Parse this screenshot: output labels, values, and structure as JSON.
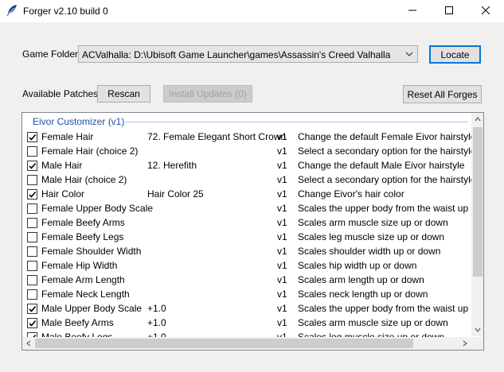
{
  "window": {
    "title": "Forger v2.10 build 0"
  },
  "game_folder": {
    "label": "Game Folder",
    "selected": "ACValhalla: D:\\Ubisoft Game Launcher\\games\\Assassin's Creed Valhalla",
    "locate_label": "Locate"
  },
  "patches": {
    "label": "Available Patches",
    "rescan_label": "Rescan",
    "install_label": "Install Updates (0)",
    "reset_label": "Reset All Forges"
  },
  "list": {
    "group_title": "Eivor Customizer (v1)",
    "rows": [
      {
        "checked": true,
        "name": "Female Hair",
        "value": "72. Female Elegant Short Crown",
        "version": "v1",
        "desc": "Change the default Female Eivor hairstyle"
      },
      {
        "checked": false,
        "name": "Female Hair (choice 2)",
        "value": "",
        "version": "v1",
        "desc": "Select a secondary option for the hairstyles that"
      },
      {
        "checked": true,
        "name": "Male Hair",
        "value": "12. Herefith",
        "version": "v1",
        "desc": "Change the default Male Eivor hairstyle"
      },
      {
        "checked": false,
        "name": "Male Hair (choice 2)",
        "value": "",
        "version": "v1",
        "desc": "Select a secondary option for the hairstyles that"
      },
      {
        "checked": true,
        "name": "Hair Color",
        "value": "Hair Color 25",
        "version": "v1",
        "desc": "Change Eivor's hair color"
      },
      {
        "checked": false,
        "name": "Female Upper Body Scale",
        "value": "",
        "version": "v1",
        "desc": "Scales the upper body from the waist up"
      },
      {
        "checked": false,
        "name": "Female Beefy Arms",
        "value": "",
        "version": "v1",
        "desc": "Scales arm muscle size up or down"
      },
      {
        "checked": false,
        "name": "Female Beefy Legs",
        "value": "",
        "version": "v1",
        "desc": "Scales leg muscle size up or down"
      },
      {
        "checked": false,
        "name": "Female Shoulder Width",
        "value": "",
        "version": "v1",
        "desc": "Scales shoulder width up or down"
      },
      {
        "checked": false,
        "name": "Female Hip Width",
        "value": "",
        "version": "v1",
        "desc": "Scales hip width up or down"
      },
      {
        "checked": false,
        "name": "Female Arm Length",
        "value": "",
        "version": "v1",
        "desc": "Scales arm length up or down"
      },
      {
        "checked": false,
        "name": "Female Neck Length",
        "value": "",
        "version": "v1",
        "desc": "Scales neck length up or down"
      },
      {
        "checked": true,
        "name": "Male Upper Body Scale",
        "value": "+1.0",
        "version": "v1",
        "desc": "Scales the upper body from the waist up"
      },
      {
        "checked": true,
        "name": "Male Beefy Arms",
        "value": "+1.0",
        "version": "v1",
        "desc": "Scales arm muscle size up or down"
      },
      {
        "checked": true,
        "name": "Male Beefy Legs",
        "value": "+1.0",
        "version": "v1",
        "desc": "Scales leg muscle size up or down"
      }
    ]
  },
  "icons": {
    "app": "quill-feather-icon",
    "minimize": "minimize-icon",
    "maximize": "maximize-icon",
    "close": "close-icon",
    "dropdown": "chevron-down-icon"
  },
  "colors": {
    "group_header": "#1e4fa5",
    "focus_border": "#0078d7"
  }
}
